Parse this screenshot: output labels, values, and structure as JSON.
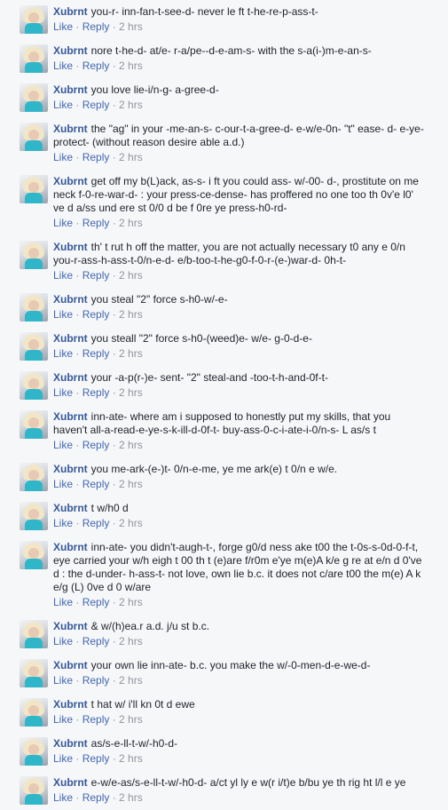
{
  "actions": {
    "like": "Like",
    "reply": "Reply",
    "sep": " · "
  },
  "comments": [
    {
      "author": "Xubrnt",
      "text": "you-r- inn-fan-t-see-d- never le ft t-he-re-p-ass-t-",
      "time": "2 hrs"
    },
    {
      "author": "Xubrnt",
      "text": "nore t-he-d- at/e- r-a/pe--d-e-am-s- with the s-a(i-)m-e-an-s-",
      "time": "2 hrs"
    },
    {
      "author": "Xubrnt",
      "text": "you love lie-i/n-g- a-gree-d-",
      "time": "2 hrs"
    },
    {
      "author": "Xubrnt",
      "text": "the \"ag\" in your -me-an-s- c-our-t-a-gree-d- e-w/e-0n- \"t\" ease- d- e-ye-protect- (without reason desire able a.d.)",
      "time": "2 hrs"
    },
    {
      "author": "Xubrnt",
      "text": "get off my b(L)ack, as-s- i ft you could ass- w/-00- d-, prostitute on me neck f-0-re-war-d- : your press-ce-dense- has proffered no one too th 0v'e l0' ve d a/ss und ere st 0/0 d be f 0re ye press-h0-rd-",
      "time": "2 hrs"
    },
    {
      "author": "Xubrnt",
      "text": "th' t rut h off the matter, you are not actually necessary t0 any e 0/n you-r-ass-h-ass-t-0/n-e-d- e/b-too-t-he-g0-f-0-r-(e-)war-d- 0h-t-",
      "time": "2 hrs"
    },
    {
      "author": "Xubrnt",
      "text": "you steal \"2\" force s-h0-w/-e-",
      "time": "2 hrs"
    },
    {
      "author": "Xubrnt",
      "text": "you steall \"2\" force s-h0-(weed)e- w/e- g-0-d-e-",
      "time": "2 hrs"
    },
    {
      "author": "Xubrnt",
      "text": "your -a-p(r-)e- sent- \"2\" steal-and -too-t-h-and-0f-t-",
      "time": "2 hrs"
    },
    {
      "author": "Xubrnt",
      "text": "inn-ate- where am i supposed to honestly put my skills, that you haven't all-a-read-e-ye-s-k-ill-d-0f-t- buy-ass-0-c-i-ate-i-0/n-s- L as/s t",
      "time": "2 hrs"
    },
    {
      "author": "Xubrnt",
      "text": "you me-ark-(e-)t- 0/n-e-me, ye me ark(e) t 0/n e w/e.",
      "time": "2 hrs"
    },
    {
      "author": "Xubrnt",
      "text": "t w/h0 d",
      "time": "2 hrs"
    },
    {
      "author": "Xubrnt",
      "text": "inn-ate- you didn't-augh-t-, forge g0/d ness ake t00 the t-0s-s-0d-0-f-t, eye carried your w/h eigh t 00 th t (e)are f/r0m e'ye m(e)A k/e g re at e/n d 0've d : the d-under- h-ass-t- not love, own lie b.c. it does not c/are t00 the m(e) A k e/g (L) 0ve d 0 w/are",
      "time": "2 hrs"
    },
    {
      "author": "Xubrnt",
      "text": "& w/(h)ea.r a.d. j/u st b.c.",
      "time": "2 hrs"
    },
    {
      "author": "Xubrnt",
      "text": "your own lie inn-ate- b.c. you make the w/-0-men-d-e-we-d-",
      "time": "2 hrs"
    },
    {
      "author": "Xubrnt",
      "text": "t hat w/ i'll kn 0t d ewe",
      "time": "2 hrs"
    },
    {
      "author": "Xubrnt",
      "text": "as/s-e-ll-t-w/-h0-d-",
      "time": "2 hrs"
    },
    {
      "author": "Xubrnt",
      "text": "e-w/e-as/s-e-ll-t-w/-h0-d- a/ct yl ly e w(r i/t)e b/bu ye th rig ht l/l e ye",
      "time": "2 hrs"
    }
  ]
}
